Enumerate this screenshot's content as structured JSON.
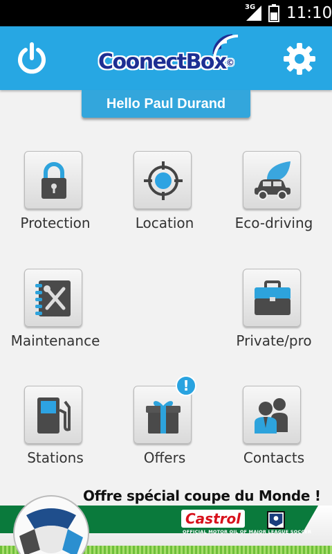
{
  "status_bar": {
    "network": "3G",
    "time": "11:10"
  },
  "header": {
    "logo_text": "CoonectBox",
    "logo_mark": "©"
  },
  "greeting": "Hello Paul Durand",
  "tiles": [
    {
      "id": "protection",
      "label": "Protection",
      "icon": "lock-icon"
    },
    {
      "id": "location",
      "label": "Location",
      "icon": "target-icon"
    },
    {
      "id": "eco-driving",
      "label": "Eco-driving",
      "icon": "car-leaf-icon"
    },
    {
      "id": "maintenance",
      "label": "Maintenance",
      "icon": "tools-notebook-icon"
    },
    {
      "id": "private-pro",
      "label": "Private/pro",
      "icon": "briefcase-icon"
    },
    {
      "id": "stations",
      "label": "Stations",
      "icon": "fuel-pump-icon"
    },
    {
      "id": "offers",
      "label": "Offers",
      "icon": "gift-icon"
    },
    {
      "id": "contacts",
      "label": "Contacts",
      "icon": "contacts-icon"
    }
  ],
  "offers_badge": "!",
  "banner": {
    "headline": "Offre spécial coupe du Monde !",
    "brand": "Castrol",
    "tagline": "OFFICIAL MOTOR OIL OF MAJOR LEAGUE SOCCER"
  },
  "colors": {
    "header_blue": "#27a7e3",
    "greeting_blue": "#33a6dc",
    "logo_navy": "#1d2f93",
    "castrol_green": "#0a7a3c",
    "castrol_red": "#d8111b"
  }
}
